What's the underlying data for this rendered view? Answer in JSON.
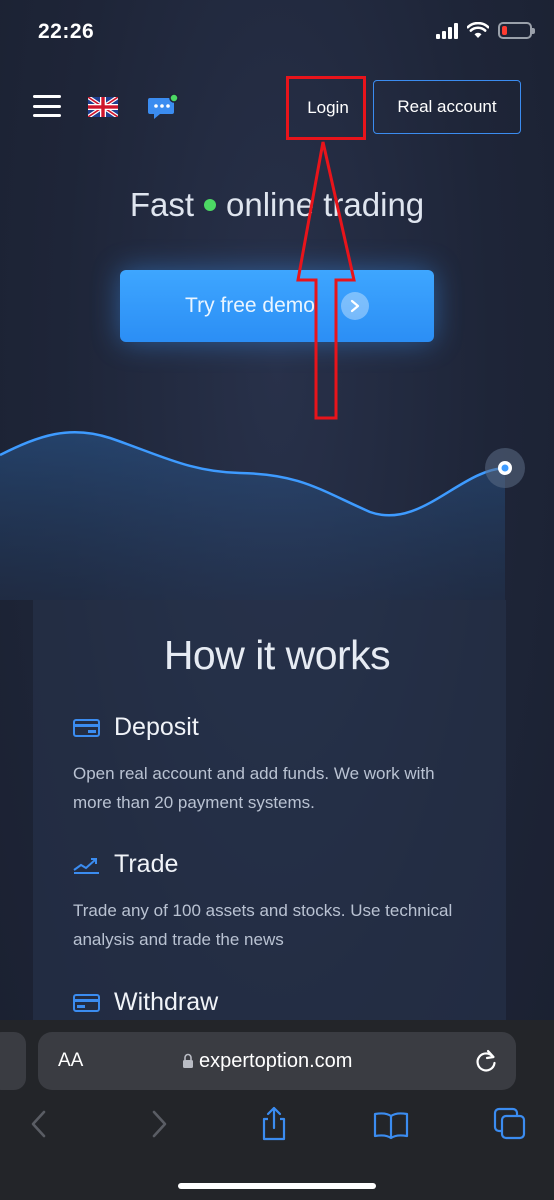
{
  "status_bar": {
    "time": "22:26"
  },
  "header": {
    "login_label": "Login",
    "real_account_label": "Real account"
  },
  "hero": {
    "title_left": "Fast",
    "title_right": "online trading",
    "demo_label": "Try free demo"
  },
  "how_it_works": {
    "title": "How it works",
    "steps": [
      {
        "title": "Deposit",
        "text": "Open real account and add funds. We work with more than 20 payment systems."
      },
      {
        "title": "Trade",
        "text": "Trade any of 100 assets and stocks. Use technical analysis and trade the news"
      },
      {
        "title": "Withdraw",
        "text": ""
      }
    ]
  },
  "browser": {
    "text_size_label": "AA",
    "url": "expertoption.com"
  },
  "colors": {
    "accent": "#2b8ef5",
    "annotation": "#e8141b",
    "online_dot": "#4cd964"
  }
}
